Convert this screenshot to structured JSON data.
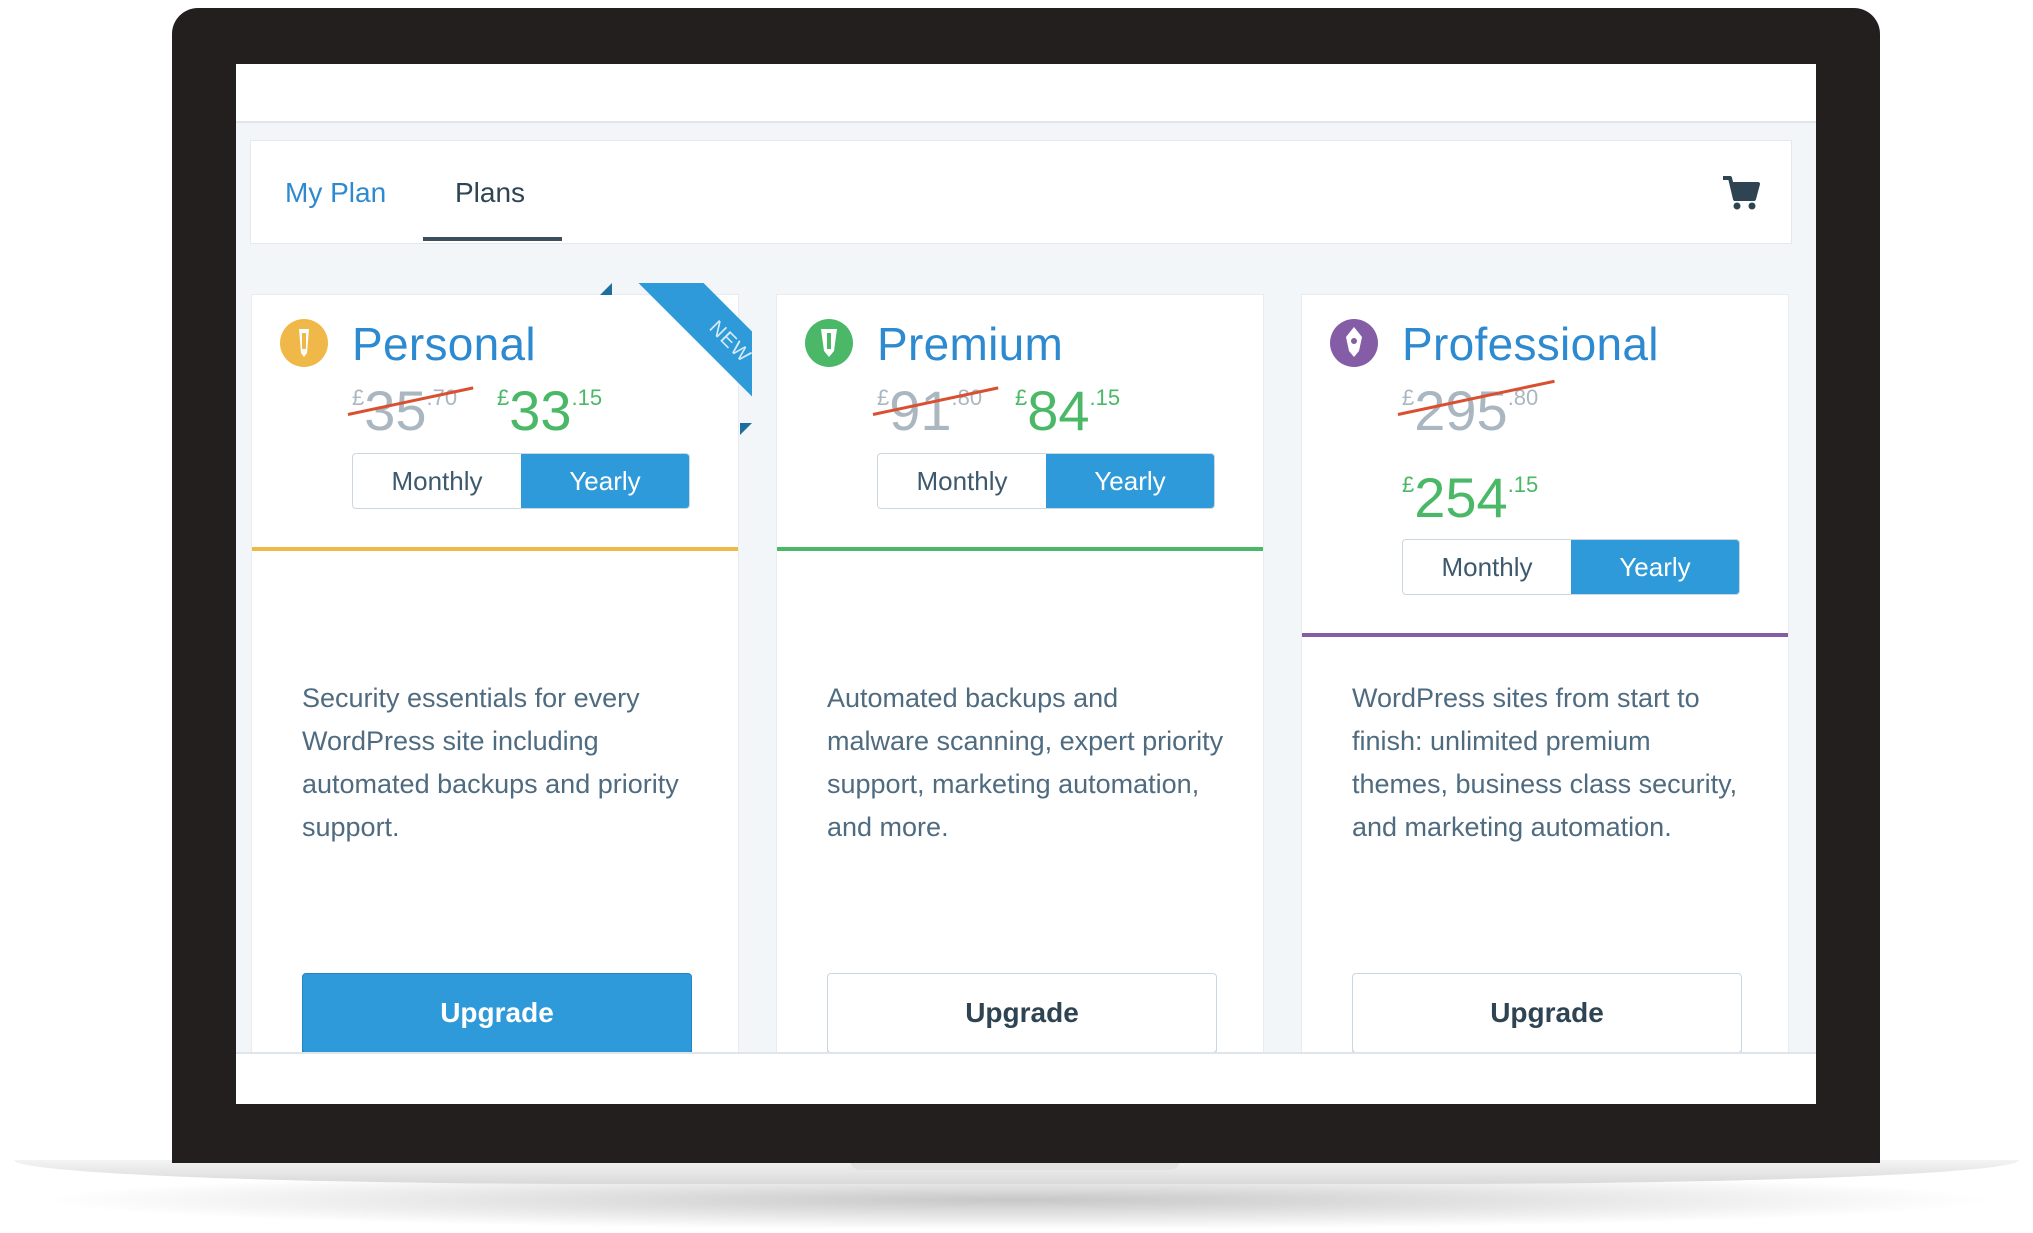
{
  "nav": {
    "tabs": [
      {
        "label": "My Plan",
        "active": false
      },
      {
        "label": "Plans",
        "active": true
      }
    ],
    "cart_icon": "cart-icon"
  },
  "colors": {
    "accent": "#2e9ad9",
    "link": "#2e8ad0",
    "price_new": "#4ab866",
    "strike": "#d94f2f",
    "personal_rule": "#f0b849",
    "premium_rule": "#4ab866",
    "professional_rule": "#855da6"
  },
  "plans": [
    {
      "name": "Personal",
      "icon": "personal-plan-icon",
      "badge": "NEW",
      "old_price": {
        "currency": "£",
        "whole": "35",
        "fraction": ".70"
      },
      "new_price": {
        "currency": "£",
        "whole": "33",
        "fraction": ".15"
      },
      "toggle": {
        "monthly": "Monthly",
        "yearly": "Yearly",
        "selected": "Yearly"
      },
      "description": "Security essentials for every WordPress site including automated backups and priority support.",
      "cta": "Upgrade"
    },
    {
      "name": "Premium",
      "icon": "premium-plan-icon",
      "old_price": {
        "currency": "£",
        "whole": "91",
        "fraction": ".80"
      },
      "new_price": {
        "currency": "£",
        "whole": "84",
        "fraction": ".15"
      },
      "toggle": {
        "monthly": "Monthly",
        "yearly": "Yearly",
        "selected": "Yearly"
      },
      "description": "Automated backups and malware scanning, expert priority support, marketing automation, and more.",
      "cta": "Upgrade"
    },
    {
      "name": "Professional",
      "icon": "professional-plan-icon",
      "old_price": {
        "currency": "£",
        "whole": "295",
        "fraction": ".80"
      },
      "new_price": {
        "currency": "£",
        "whole": "254",
        "fraction": ".15"
      },
      "toggle": {
        "monthly": "Monthly",
        "yearly": "Yearly",
        "selected": "Yearly"
      },
      "description": "WordPress sites from start to finish: unlimited premium themes, business class security, and marketing automation.",
      "cta": "Upgrade"
    }
  ]
}
